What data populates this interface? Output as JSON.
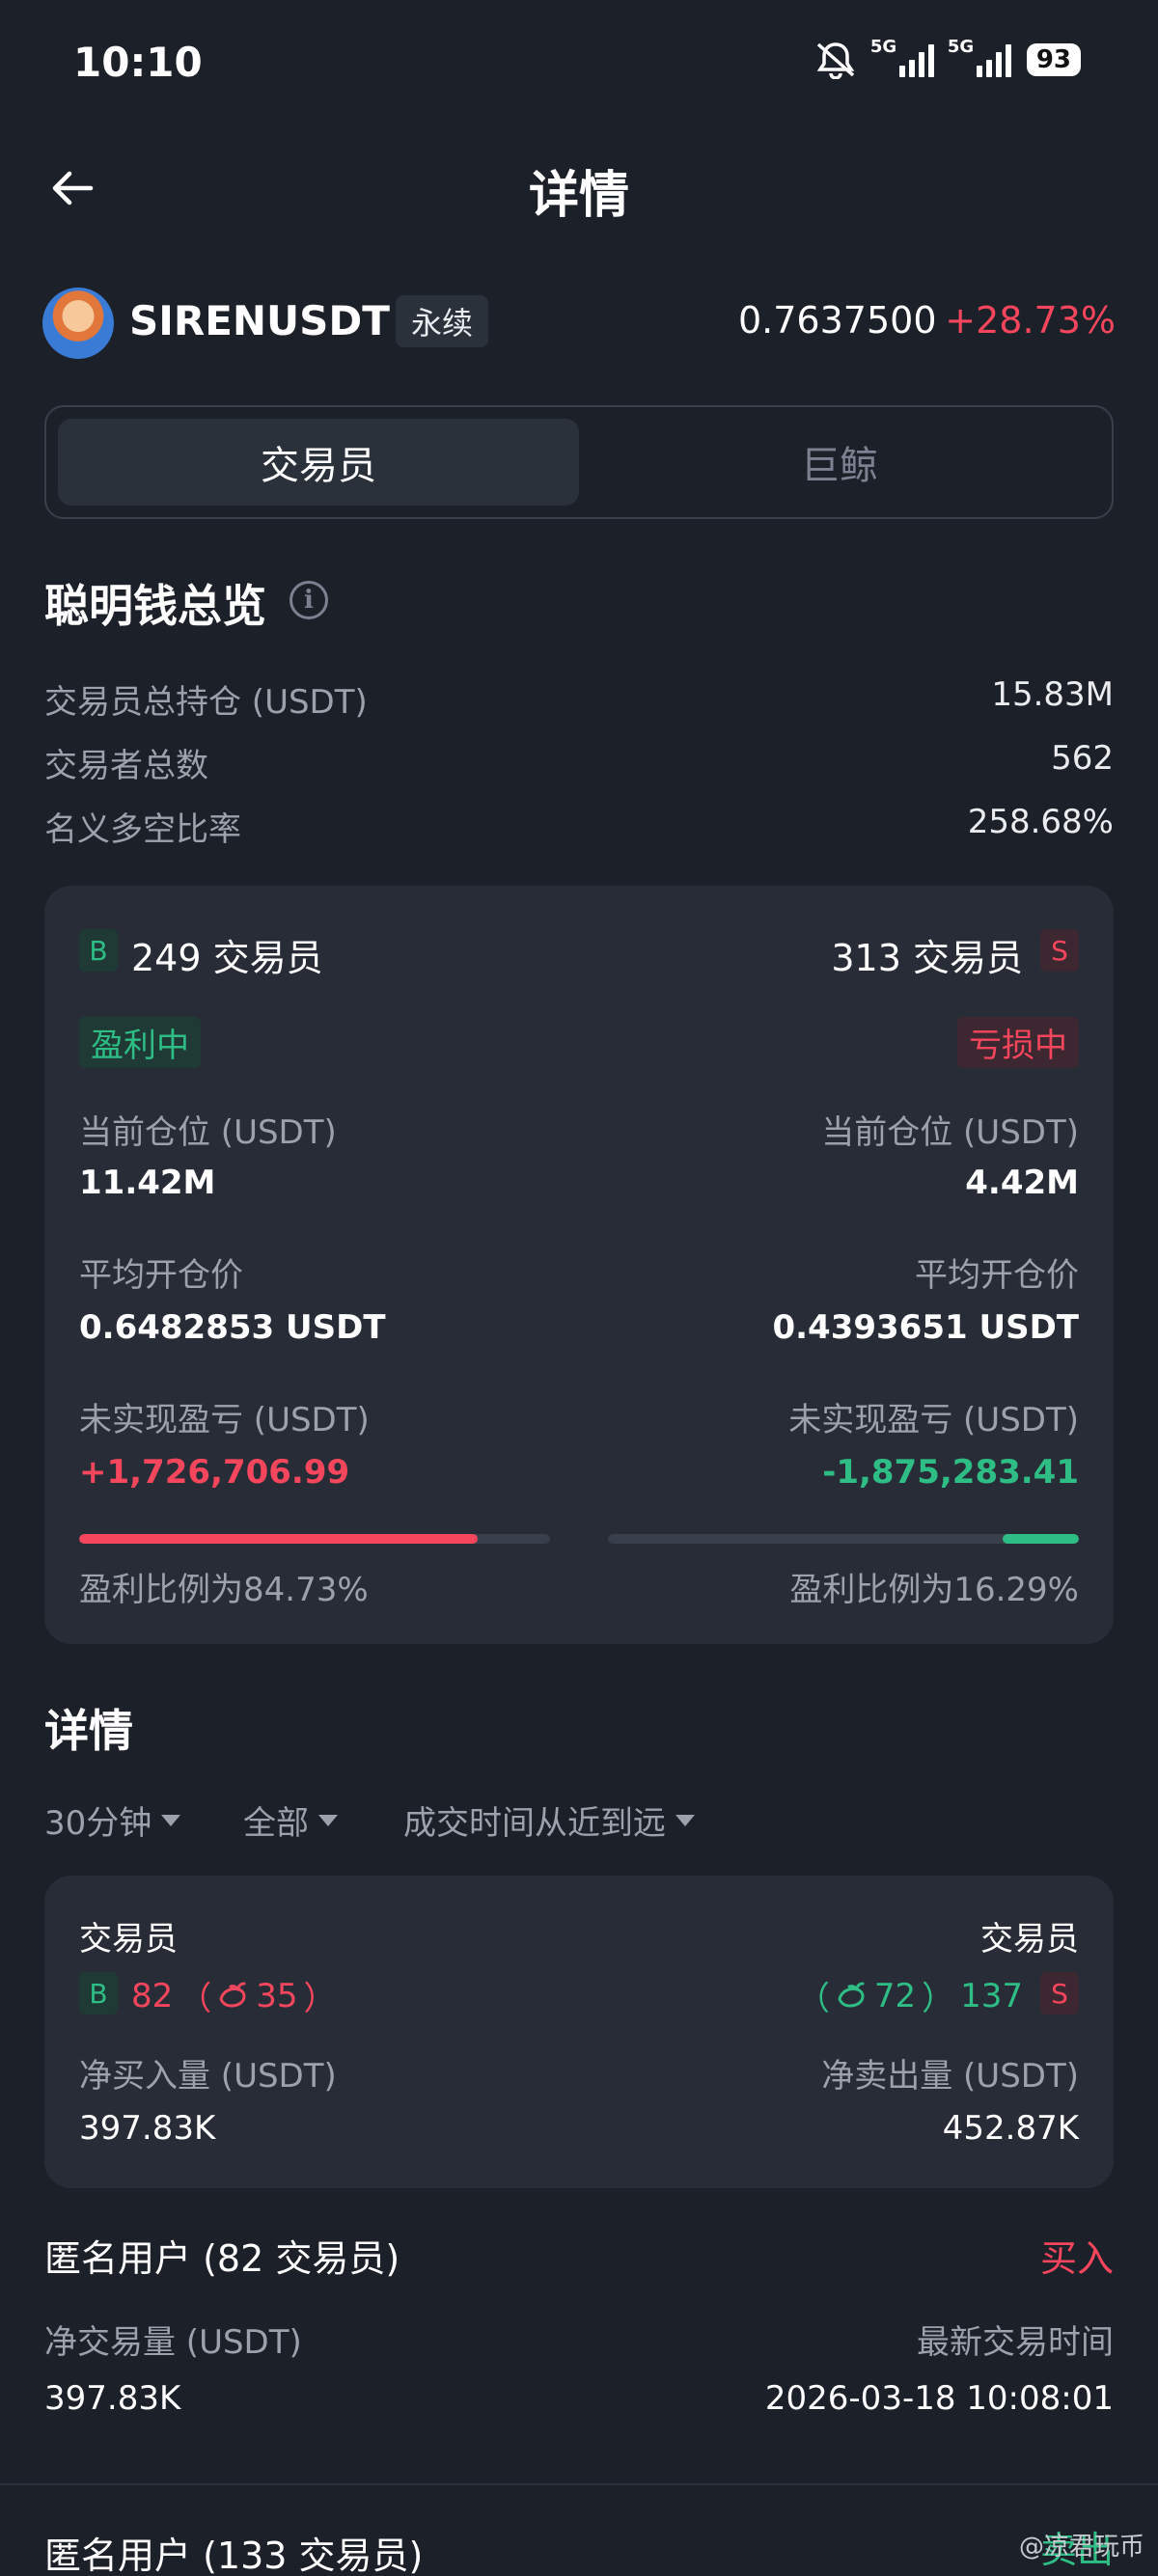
{
  "status_bar": {
    "time": "10:10",
    "battery": "93",
    "net1": "5G",
    "net2": "5G"
  },
  "header": {
    "title": "详情"
  },
  "symbol": {
    "name": "SIRENUSDT",
    "type": "永续",
    "price": "0.7637500",
    "change": "+28.73%"
  },
  "tabs": [
    {
      "label": "交易员"
    },
    {
      "label": "巨鲸"
    }
  ],
  "overview": {
    "title": "聪明钱总览",
    "rows": [
      {
        "label": "交易员总持仓 (USDT)",
        "value": "15.83M"
      },
      {
        "label": "交易者总数",
        "value": "562"
      },
      {
        "label": "名义多空比率",
        "value": "258.68%"
      }
    ]
  },
  "summary_card": {
    "long": {
      "badge": "B",
      "traders": "249 交易员",
      "status": "盈利中",
      "position_label": "当前仓位 (USDT)",
      "position": "11.42M",
      "avg_label": "平均开仓价",
      "avg": "0.6482853 USDT",
      "pnl_label": "未实现盈亏 (USDT)",
      "pnl": "+1,726,706.99",
      "ratio_label": "盈利比例为84.73%",
      "ratio": 0.8473
    },
    "short": {
      "badge": "S",
      "traders": "313 交易员",
      "status": "亏损中",
      "position_label": "当前仓位 (USDT)",
      "position": "4.42M",
      "avg_label": "平均开仓价",
      "avg": "0.4393651 USDT",
      "pnl_label": "未实现盈亏 (USDT)",
      "pnl": "-1,875,283.41",
      "ratio_label": "盈利比例为16.29%",
      "ratio": 0.1629
    }
  },
  "details": {
    "title": "详情",
    "filters": [
      "30分钟",
      "全部",
      "成交时间从近到远"
    ],
    "card": {
      "buy_header": "交易员",
      "sell_header": "交易员",
      "buy_badge": "B",
      "buy_count": "82",
      "buy_whale": "35",
      "sell_badge": "S",
      "sell_count": "137",
      "sell_whale": "72",
      "buy_label": "净买入量 (USDT)",
      "buy_value": "397.83K",
      "sell_label": "净卖出量 (USDT)",
      "sell_value": "452.87K"
    },
    "items": [
      {
        "name": "匿名用户 (82 交易员)",
        "side": "买入",
        "vol_label": "净交易量 (USDT)",
        "vol": "397.83K",
        "time_label": "最新交易时间",
        "time": "2026-03-18 10:08:01"
      },
      {
        "name": "匿名用户 (133 交易员)",
        "side": "卖出"
      }
    ]
  },
  "watermark": "@凉君玩币"
}
